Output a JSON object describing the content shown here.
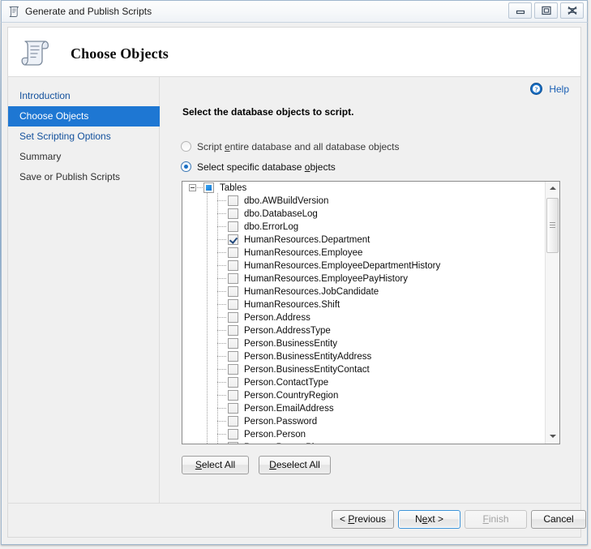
{
  "window": {
    "title": "Generate and Publish Scripts",
    "icon": "script-document-icon",
    "controls": {
      "minimize": "minimize-button",
      "maximize": "maximize-button",
      "close": "close-button"
    }
  },
  "banner": {
    "title": "Choose Objects",
    "icon": "script-scroll-icon"
  },
  "sidebar": {
    "items": [
      {
        "label": "Introduction",
        "active": false
      },
      {
        "label": "Choose Objects",
        "active": true
      },
      {
        "label": "Set Scripting Options",
        "active": false
      },
      {
        "label": "Summary",
        "active": false
      },
      {
        "label": "Save or Publish Scripts",
        "active": false
      }
    ]
  },
  "content": {
    "help_label": "Help",
    "help_icon": "help-circle-icon",
    "heading": "Select the database objects to script.",
    "radio_options": [
      {
        "label_before": "Script ",
        "mnemonic": "e",
        "label_after": "ntire database and all database objects",
        "selected": false
      },
      {
        "label_before": "Select specific database ",
        "mnemonic": "o",
        "label_after": "bjects",
        "selected": true
      }
    ],
    "tree": {
      "root": {
        "label": "Tables",
        "state": "partial",
        "expanded": true
      },
      "items": [
        {
          "label": "dbo.AWBuildVersion",
          "checked": false
        },
        {
          "label": "dbo.DatabaseLog",
          "checked": false
        },
        {
          "label": "dbo.ErrorLog",
          "checked": false
        },
        {
          "label": "HumanResources.Department",
          "checked": true
        },
        {
          "label": "HumanResources.Employee",
          "checked": false
        },
        {
          "label": "HumanResources.EmployeeDepartmentHistory",
          "checked": false
        },
        {
          "label": "HumanResources.EmployeePayHistory",
          "checked": false
        },
        {
          "label": "HumanResources.JobCandidate",
          "checked": false
        },
        {
          "label": "HumanResources.Shift",
          "checked": false
        },
        {
          "label": "Person.Address",
          "checked": false
        },
        {
          "label": "Person.AddressType",
          "checked": false
        },
        {
          "label": "Person.BusinessEntity",
          "checked": false
        },
        {
          "label": "Person.BusinessEntityAddress",
          "checked": false
        },
        {
          "label": "Person.BusinessEntityContact",
          "checked": false
        },
        {
          "label": "Person.ContactType",
          "checked": false
        },
        {
          "label": "Person.CountryRegion",
          "checked": false
        },
        {
          "label": "Person.EmailAddress",
          "checked": false
        },
        {
          "label": "Person.Password",
          "checked": false
        },
        {
          "label": "Person.Person",
          "checked": false
        },
        {
          "label": "Person.PersonPhone",
          "checked": false
        }
      ]
    },
    "buttons": {
      "select_all_mnemonic": "S",
      "select_all_rest": "elect All",
      "deselect_all_mnemonic": "D",
      "deselect_all_rest": "eselect All"
    }
  },
  "footer": {
    "previous": {
      "before": "< ",
      "mnemonic": "P",
      "after": "revious",
      "enabled": true
    },
    "next": {
      "before": "N",
      "mnemonic": "e",
      "after": "xt >",
      "enabled": true,
      "default": true
    },
    "finish": {
      "before": "",
      "mnemonic": "F",
      "after": "inish",
      "enabled": false
    },
    "cancel": {
      "before": "",
      "mnemonic": "",
      "after": "Cancel",
      "enabled": true
    }
  },
  "colors": {
    "accent_selected": "#1e77d3",
    "link": "#12509c",
    "help_link": "#1a5fb4",
    "window_bg": "#f0f0f0",
    "default_button_border": "#3c93d8"
  }
}
